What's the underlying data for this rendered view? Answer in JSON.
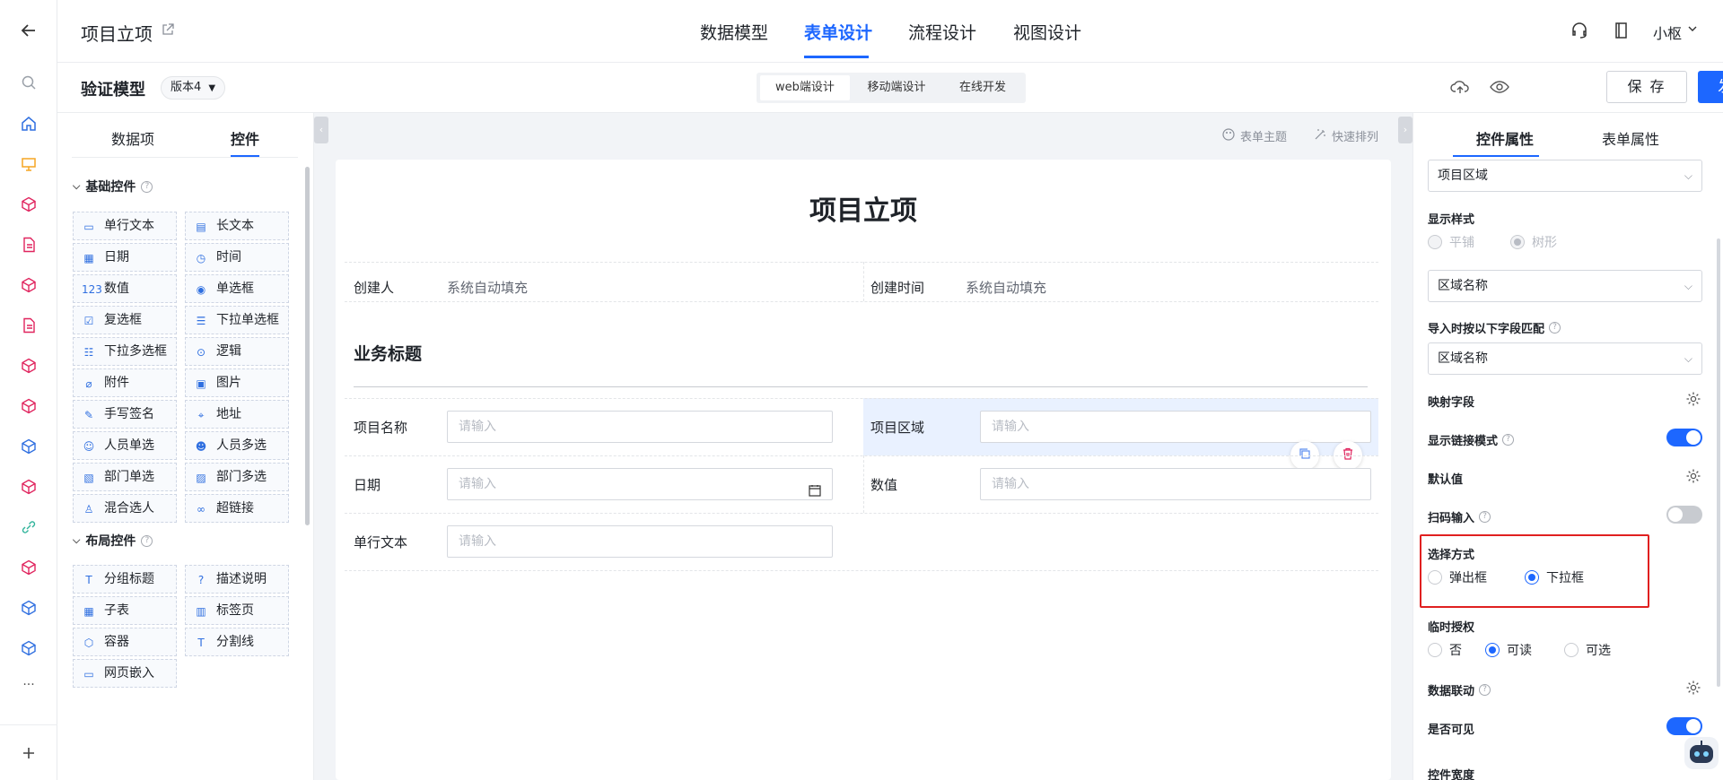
{
  "colors": {
    "accent": "#1d67ff",
    "danger": "#e02020",
    "rail_icon": "#e0245e"
  },
  "topbar": {
    "app_title": "项目立项",
    "tabs": [
      {
        "label": "数据模型",
        "active": false
      },
      {
        "label": "表单设计",
        "active": true
      },
      {
        "label": "流程设计",
        "active": false
      },
      {
        "label": "视图设计",
        "active": false
      }
    ],
    "user_name": "小枢"
  },
  "subbar": {
    "model_title": "验证模型",
    "version": "版本4",
    "device_tabs": [
      {
        "label": "web端设计",
        "active": true
      },
      {
        "label": "移动端设计",
        "active": false
      },
      {
        "label": "在线开发",
        "active": false
      }
    ],
    "save_label": "保 存",
    "publish_label": "发 布"
  },
  "left_panel": {
    "tabs": [
      {
        "label": "数据项",
        "active": false
      },
      {
        "label": "控件",
        "active": true
      }
    ],
    "groups": [
      {
        "title": "基础控件",
        "items": [
          {
            "label": "单行文本",
            "icon": "single-line-text-icon"
          },
          {
            "label": "长文本",
            "icon": "long-text-icon"
          },
          {
            "label": "日期",
            "icon": "date-icon"
          },
          {
            "label": "时间",
            "icon": "time-icon"
          },
          {
            "label": "数值",
            "icon": "number-icon"
          },
          {
            "label": "单选框",
            "icon": "radio-icon"
          },
          {
            "label": "复选框",
            "icon": "checkbox-icon"
          },
          {
            "label": "下拉单选框",
            "icon": "dropdown-single-icon"
          },
          {
            "label": "下拉多选框",
            "icon": "dropdown-multi-icon"
          },
          {
            "label": "逻辑",
            "icon": "logic-toggle-icon"
          },
          {
            "label": "附件",
            "icon": "attachment-icon"
          },
          {
            "label": "图片",
            "icon": "image-icon"
          },
          {
            "label": "手写签名",
            "icon": "signature-icon"
          },
          {
            "label": "地址",
            "icon": "location-icon"
          },
          {
            "label": "人员单选",
            "icon": "user-single-icon"
          },
          {
            "label": "人员多选",
            "icon": "user-multi-icon"
          },
          {
            "label": "部门单选",
            "icon": "dept-single-icon"
          },
          {
            "label": "部门多选",
            "icon": "dept-multi-icon"
          },
          {
            "label": "混合选人",
            "icon": "mixed-user-icon"
          },
          {
            "label": "超链接",
            "icon": "hyperlink-icon"
          }
        ]
      },
      {
        "title": "布局控件",
        "items": [
          {
            "label": "分组标题",
            "icon": "group-title-icon"
          },
          {
            "label": "描述说明",
            "icon": "description-icon"
          },
          {
            "label": "子表",
            "icon": "subtable-icon"
          },
          {
            "label": "标签页",
            "icon": "tabs-icon"
          },
          {
            "label": "容器",
            "icon": "container-icon"
          },
          {
            "label": "分割线",
            "icon": "divider-icon"
          },
          {
            "label": "网页嵌入",
            "icon": "webpage-embed-icon"
          }
        ]
      }
    ]
  },
  "canvas": {
    "tools": [
      {
        "label": "表单主题",
        "icon": "palette-icon"
      },
      {
        "label": "快速排列",
        "icon": "magic-wand-icon"
      }
    ],
    "form_title": "项目立项",
    "creator_label": "创建人",
    "creator_value": "系统自动填充",
    "created_time_label": "创建时间",
    "created_time_value": "系统自动填充",
    "section_title": "业务标题",
    "fields": [
      {
        "label": "项目名称",
        "placeholder": "请输入"
      },
      {
        "label": "项目区域",
        "placeholder": "请输入"
      },
      {
        "label": "日期",
        "placeholder": "请输入"
      },
      {
        "label": "数值",
        "placeholder": "请输入"
      },
      {
        "label": "单行文本",
        "placeholder": "请输入"
      }
    ]
  },
  "right_panel": {
    "tabs": [
      {
        "label": "控件属性",
        "active": true
      },
      {
        "label": "表单属性",
        "active": false
      }
    ],
    "data_source_value": "项目区域",
    "display_style_label": "显示样式",
    "display_style_options": [
      {
        "label": "平铺",
        "selected": false
      },
      {
        "label": "树形",
        "selected": true
      }
    ],
    "display_field_value": "区域名称",
    "import_match_label": "导入时按以下字段匹配",
    "import_match_value": "区域名称",
    "mapping_label": "映射字段",
    "link_mode_label": "显示链接模式",
    "link_mode_on": true,
    "default_label": "默认值",
    "scan_label": "扫码输入",
    "scan_on": false,
    "select_mode_label": "选择方式",
    "select_mode_options": [
      {
        "label": "弹出框",
        "selected": false
      },
      {
        "label": "下拉框",
        "selected": true
      }
    ],
    "temp_auth_label": "临时授权",
    "temp_auth_options": [
      {
        "label": "否",
        "selected": false
      },
      {
        "label": "可读",
        "selected": true
      },
      {
        "label": "可选",
        "selected": false
      }
    ],
    "data_link_label": "数据联动",
    "visible_label": "是否可见",
    "visible_on": true,
    "width_label": "控件宽度"
  }
}
